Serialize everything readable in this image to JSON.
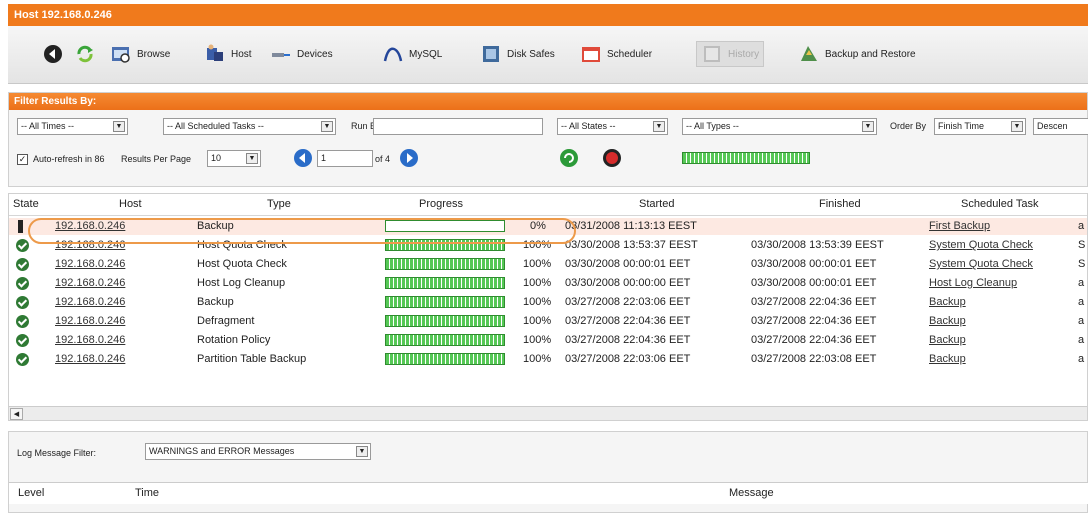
{
  "window": {
    "title": "Host 192.168.0.246"
  },
  "toolbar": {
    "browse": "Browse",
    "host": "Host",
    "devices": "Devices",
    "mysql": "MySQL",
    "disk_safes": "Disk Safes",
    "scheduler": "Scheduler",
    "history": "History",
    "backup_restore": "Backup and Restore"
  },
  "filter": {
    "heading": "Filter Results By:",
    "times": "-- All Times --",
    "scheduled_tasks": "-- All Scheduled Tasks --",
    "run_by_label": "Run By",
    "run_by_value": "",
    "states": "-- All States --",
    "types": "-- All Types --",
    "order_by_label": "Order By",
    "order_by_value": "Finish Time",
    "order_dir": "Descen",
    "auto_refresh": "Auto-refresh in 86",
    "auto_refresh_checked": true,
    "results_per_page_label": "Results Per Page",
    "results_per_page": "10",
    "page_value": "1",
    "page_of": "of 4"
  },
  "results": {
    "headers": {
      "state": "State",
      "host": "Host",
      "type": "Type",
      "progress": "Progress",
      "started": "Started",
      "finished": "Finished",
      "scheduled_task": "Scheduled Task"
    },
    "rows": [
      {
        "state": "running",
        "host": "192.168.0.246",
        "type": "Backup",
        "progress": 0,
        "progress_text": "0%",
        "started": "03/31/2008 11:13:13 EEST",
        "finished": "",
        "task": "First Backup",
        "extra": "a"
      },
      {
        "state": "ok",
        "host": "192.168.0.246",
        "type": "Host Quota Check",
        "progress": 100,
        "progress_text": "100%",
        "started": "03/30/2008 13:53:37 EEST",
        "finished": "03/30/2008 13:53:39 EEST",
        "task": "System Quota Check",
        "extra": "S"
      },
      {
        "state": "ok",
        "host": "192.168.0.246",
        "type": "Host Quota Check",
        "progress": 100,
        "progress_text": "100%",
        "started": "03/30/2008 00:00:01 EET",
        "finished": "03/30/2008 00:00:01 EET",
        "task": "System Quota Check",
        "extra": "S"
      },
      {
        "state": "ok",
        "host": "192.168.0.246",
        "type": "Host Log Cleanup",
        "progress": 100,
        "progress_text": "100%",
        "started": "03/30/2008 00:00:00 EET",
        "finished": "03/30/2008 00:00:01 EET",
        "task": "Host Log Cleanup",
        "extra": "a"
      },
      {
        "state": "ok",
        "host": "192.168.0.246",
        "type": "Backup",
        "progress": 100,
        "progress_text": "100%",
        "started": "03/27/2008 22:03:06 EET",
        "finished": "03/27/2008 22:04:36 EET",
        "task": "Backup",
        "extra": "a"
      },
      {
        "state": "ok",
        "host": "192.168.0.246",
        "type": "Defragment",
        "progress": 100,
        "progress_text": "100%",
        "started": "03/27/2008 22:04:36 EET",
        "finished": "03/27/2008 22:04:36 EET",
        "task": "Backup",
        "extra": "a"
      },
      {
        "state": "ok",
        "host": "192.168.0.246",
        "type": "Rotation Policy",
        "progress": 100,
        "progress_text": "100%",
        "started": "03/27/2008 22:04:36 EET",
        "finished": "03/27/2008 22:04:36 EET",
        "task": "Backup",
        "extra": "a"
      },
      {
        "state": "ok",
        "host": "192.168.0.246",
        "type": "Partition Table Backup",
        "progress": 100,
        "progress_text": "100%",
        "started": "03/27/2008 22:03:06 EET",
        "finished": "03/27/2008 22:03:08 EET",
        "task": "Backup",
        "extra": "a"
      }
    ]
  },
  "log": {
    "filter_label": "Log Message Filter:",
    "filter_value": "WARNINGS and ERROR Messages",
    "headers": {
      "level": "Level",
      "time": "Time",
      "message": "Message"
    }
  },
  "colors": {
    "accent": "#f07a1c",
    "progress": "#56c856",
    "ok": "#2f7a34",
    "highlight_row": "#fde9e2"
  }
}
